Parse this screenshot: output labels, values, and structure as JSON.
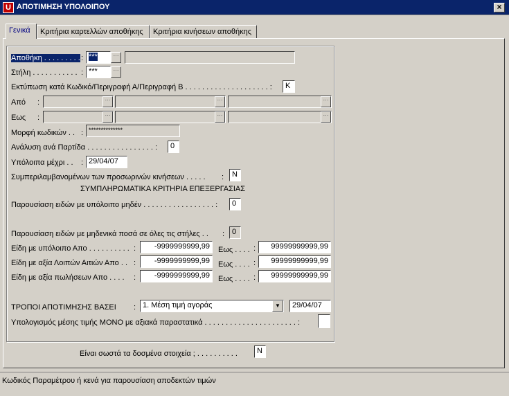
{
  "window": {
    "title": "ΑΠΟΤΙΜΗΣΗ ΥΠΟΛΟΙΠΟΥ",
    "app_icon": "U",
    "close_glyph": "×"
  },
  "tabs": [
    {
      "label": "Γενικά",
      "active": true
    },
    {
      "label": "Κριτήρια καρτελλών αποθήκης",
      "active": false
    },
    {
      "label": "Κριτήρια κινήσεων αποθήκης",
      "active": false
    }
  ],
  "form": {
    "warehouse": {
      "label": "Αποθήκη . . . . . . . . .",
      "colon": ":",
      "value": "***",
      "desc": ""
    },
    "column": {
      "label": "Στήλη . . . . . . . . . . .",
      "colon": ":",
      "value": "***"
    },
    "print_by": {
      "label": "Εκτύπωση κατά Κωδικό/Περιγραφή Α/Περιγραφή Β . . . . . . . . . . . . . . . . . . . . :",
      "value": "Κ"
    },
    "from": {
      "label": "Από",
      "colon": ":"
    },
    "to": {
      "label": "Εως",
      "colon": ":"
    },
    "code_format": {
      "label": "Μορφή κωδικών . .",
      "colon": ":",
      "value": "**************"
    },
    "lot_analysis": {
      "label": "Ανάλυση ανά Παρτίδα . . . . . . . . . . . . . . . . :",
      "value": "0"
    },
    "balances_until": {
      "label": "Υπόλοιπα μέχρι . .",
      "colon": ":",
      "value": "29/04/07"
    },
    "include_temp": {
      "label": "Συμπεριλαμβανομένων των προσωρινών κινήσεων . . . . .",
      "colon": ":",
      "value": "N"
    },
    "section_heading": "ΣΥΜΠΛΗΡΩΜΑΤΙΚΑ ΚΡΙΤΗΡΙΑ ΕΠΕΞΕΡΓΑΣΙΑΣ",
    "zero_balance": {
      "label": "Παρουσίαση ειδών με υπόλοιπο μηδέν . . . . . . . . . . . . . . . . . :",
      "value": "0"
    },
    "zero_amounts": {
      "label": "Παρουσίαση ειδών με μηδενικά ποσά σε όλες τις στήλες . .",
      "colon": ":",
      "value": "0"
    },
    "ranges": [
      {
        "label": "Είδη με υπόλοιπο Απο . . . . . . . . . .",
        "colon": ":",
        "from": "-9999999999,99",
        "to_label": "Εως . . . .",
        "to_colon": ":",
        "to": "99999999999,99"
      },
      {
        "label": "Είδη με αξία Λοιπών Αιτιών Απο . .",
        "colon": ":",
        "from": "-9999999999,99",
        "to_label": "Εως . . . .",
        "to_colon": ":",
        "to": "99999999999,99"
      },
      {
        "label": "Είδη με αξία πωλήσεων Απο . . . .",
        "colon": ":",
        "from": "-9999999999,99",
        "to_label": "Εως . . . .",
        "to_colon": ":",
        "to": "99999999999,99"
      }
    ],
    "valuation_method": {
      "label": "ΤΡΟΠΟΙ ΑΠΟΤΙΜΗΣΗΣ ΒΑΣΕΙ",
      "colon": ":",
      "selected": "1. Μέση τιμή αγοράς",
      "date": "29/04/07"
    },
    "avg_price_calc": {
      "label": "Υπολογισμός μέσης τιμής ΜΟΝΟ με αξιακά παραστατικά . . . . . . . . . . . . . . . . . . . . . . :",
      "value": ""
    }
  },
  "confirm": {
    "label": "Είναι σωστά τα δοσμένα στοιχεία ; . . . . . . . . . .",
    "value": "N"
  },
  "status": {
    "text": "Κωδικός Παραμέτρου ή κενά για παρουσίαση αποδεκτών τιμών"
  },
  "buttons": {
    "lookup_glyph": "···",
    "dropdown_glyph": "▼"
  },
  "colors": {
    "titlebar": "#0a246a",
    "window": "#d4d0c8",
    "selection": "#0a246a"
  }
}
